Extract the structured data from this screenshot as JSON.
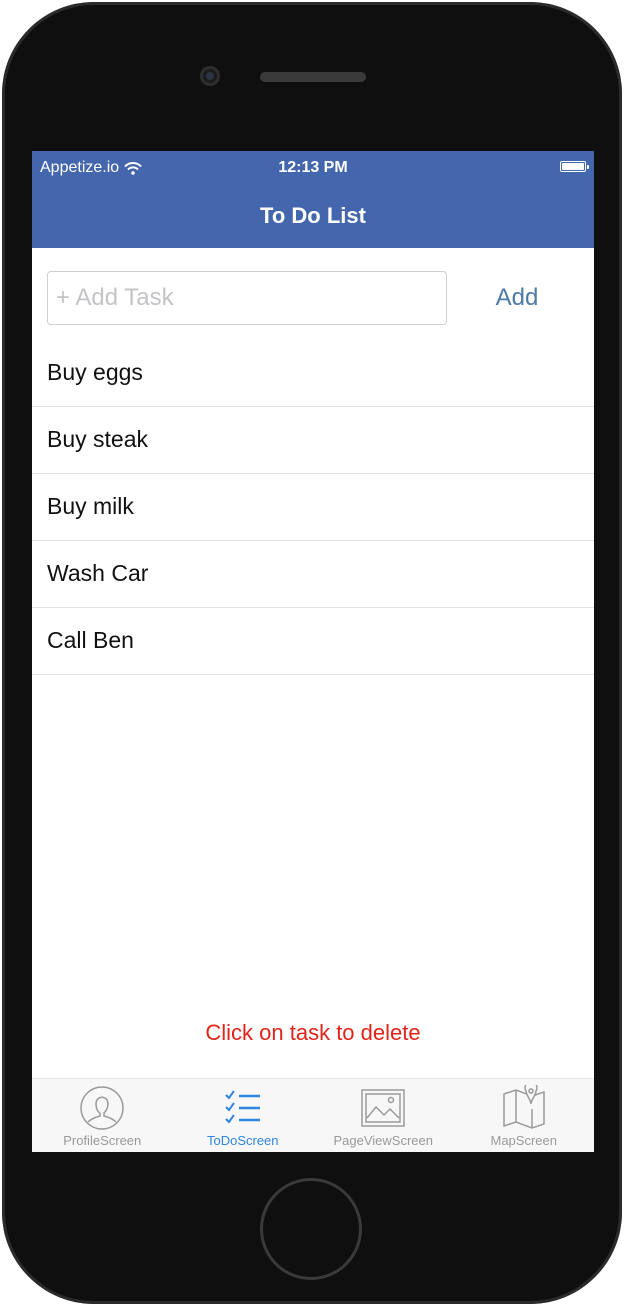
{
  "status_bar": {
    "carrier": "Appetize.io",
    "time": "12:13 PM"
  },
  "nav": {
    "title": "To Do List"
  },
  "add_row": {
    "placeholder": "+ Add Task",
    "value": "",
    "add_label": "Add"
  },
  "tasks": [
    {
      "label": "Buy eggs"
    },
    {
      "label": "Buy steak"
    },
    {
      "label": "Buy milk"
    },
    {
      "label": "Wash Car"
    },
    {
      "label": "Call Ben"
    }
  ],
  "hint": "Click on task to delete",
  "tabbar": {
    "tabs": [
      {
        "label": "ProfileScreen",
        "icon": "profile-icon"
      },
      {
        "label": "ToDoScreen",
        "icon": "checklist-icon",
        "active": true
      },
      {
        "label": "PageViewScreen",
        "icon": "image-icon"
      },
      {
        "label": "MapScreen",
        "icon": "map-icon"
      }
    ]
  },
  "colors": {
    "nav_bg": "#4466ac",
    "accent": "#2f86de",
    "link": "#4d7aa6",
    "hint": "#e2231a"
  }
}
